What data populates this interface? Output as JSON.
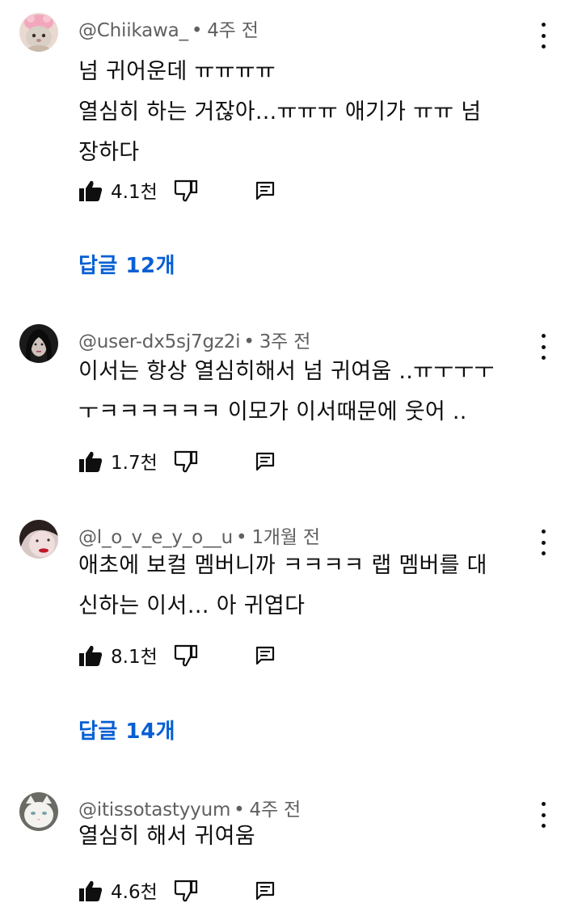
{
  "comments": [
    {
      "author": "@Chiikawa_",
      "separator": "•",
      "time": "4주 전",
      "text": "넘 귀어운데 ㅠㅠㅠㅠ\n열심히 하는 거잖아...ㅠㅠㅠ 애기가 ㅠㅠ 넘\n장하다",
      "likes": "4.1천",
      "replies_label": "답글 12개",
      "avatar": "pink-hat-character-avatar"
    },
    {
      "author": "@user-dx5sj7gz2i",
      "separator": "•",
      "time": "3주 전",
      "text": "이서는 항상 열심히해서 넘 귀여움 ..ㅠㅜㅜㅜ\nㅜㅋㅋㅋㅋㅋㅋ 이모가 이서때문에 웃어 ..",
      "likes": "1.7천",
      "avatar": "dark-hair-portrait-avatar"
    },
    {
      "author": "@l_o_v_e_y_o__u",
      "separator": "•",
      "time": "1개월 전",
      "text": "애초에 보컬 멤버니까 ㅋㅋㅋㅋ 랩 멤버를 대\n신하는 이서… 아 귀엽다",
      "likes": "8.1천",
      "replies_label": "답글 14개",
      "avatar": "red-lips-portrait-avatar"
    },
    {
      "author": "@itissotastyyum",
      "separator": "•",
      "time": "4주 전",
      "text": "열심히 해서 귀여움",
      "likes": "4.6천",
      "avatar": "white-cat-avatar"
    }
  ],
  "colors": {
    "text": "#0f0f0f",
    "meta": "#606060",
    "link": "#065fd4",
    "background": "#ffffff"
  }
}
